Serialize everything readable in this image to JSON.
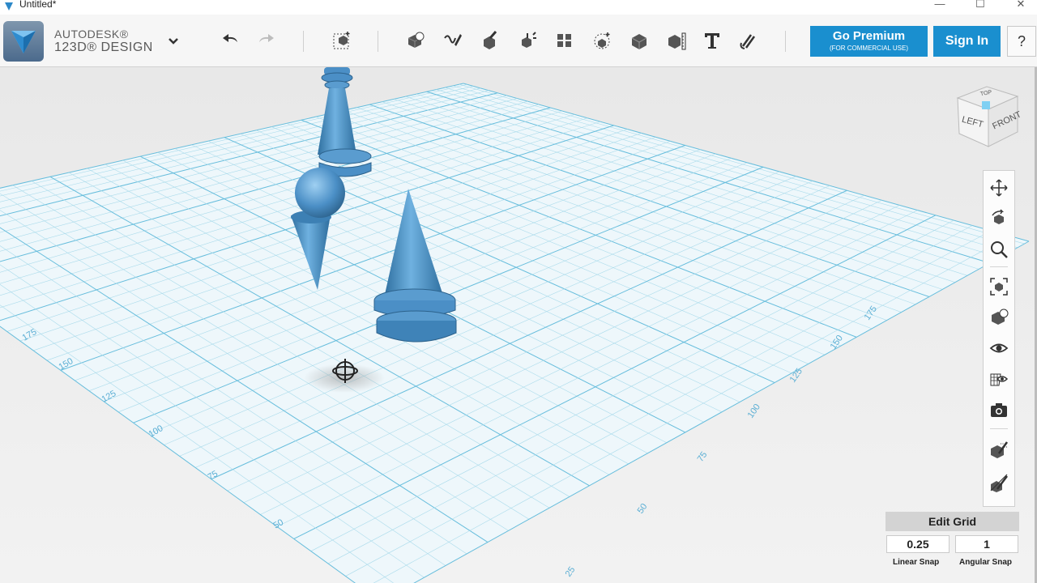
{
  "window": {
    "title": "Untitled*",
    "minimize": "—",
    "maximize": "☐",
    "close": "✕"
  },
  "brand": {
    "line1": "AUTODESK®",
    "line2": "123D® DESIGN"
  },
  "toolbar": {
    "tools": [
      "undo-icon",
      "redo-icon",
      "transform-icon",
      "primitives-icon",
      "sketch-icon",
      "construct-icon",
      "modify-icon",
      "pattern-icon",
      "grouping-icon",
      "combine-icon",
      "measure-icon",
      "text-icon",
      "snap-icon"
    ]
  },
  "premium": {
    "title": "Go Premium",
    "subtitle": "(FOR COMMERCIAL USE)"
  },
  "signin": {
    "label": "Sign In"
  },
  "help": {
    "label": "?"
  },
  "viewcube": {
    "top": "TOP",
    "left": "LEFT",
    "front": "FRONT"
  },
  "grid": {
    "left_labels": [
      "175",
      "150",
      "125",
      "100",
      "75",
      "50",
      "25"
    ],
    "right_labels": [
      "175",
      "150",
      "125",
      "100",
      "75",
      "50",
      "25"
    ],
    "top_right_labels": [
      "175",
      "150",
      "125"
    ]
  },
  "navbar": [
    "pan-icon",
    "orbit-icon",
    "zoom-icon",
    "fit-icon",
    "views-icon",
    "visibility-icon",
    "material-icon",
    "snapshot-icon",
    "snap-on-icon",
    "snap-off-icon"
  ],
  "edit_grid": {
    "title": "Edit Grid",
    "linear_snap": "0.25",
    "angular_snap": "1",
    "linear_label": "Linear Snap",
    "angular_label": "Angular Snap"
  },
  "colors": {
    "accent": "#1a8fcf",
    "model": "#4b8fc6",
    "grid": "#8ecbe0"
  }
}
